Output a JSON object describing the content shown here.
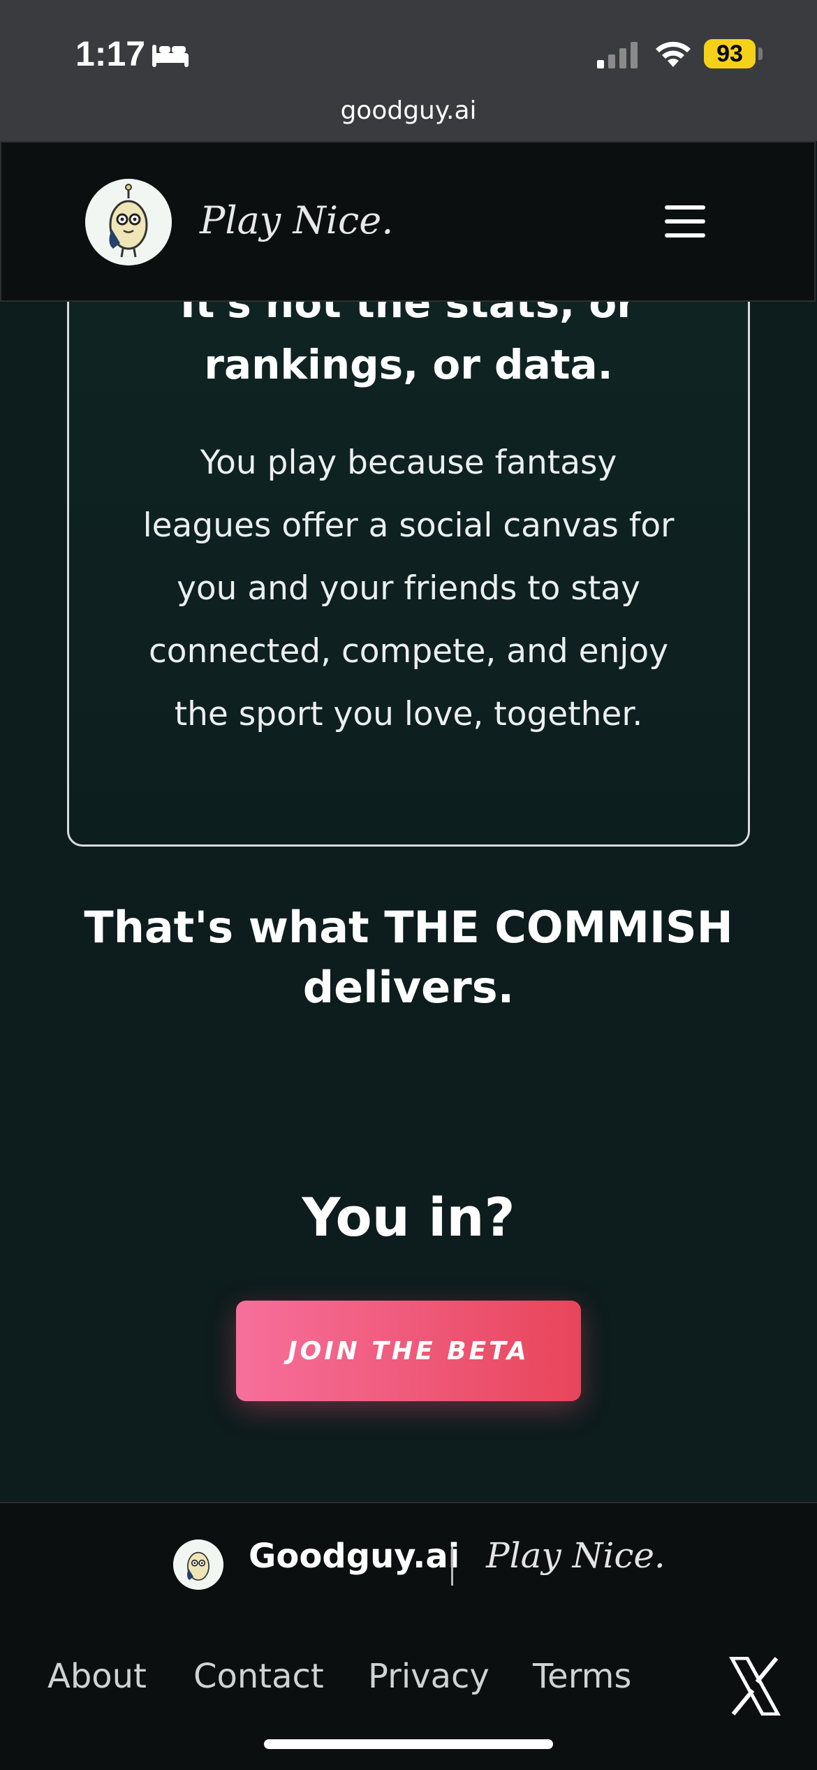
{
  "status": {
    "time": "1:17",
    "battery": "93",
    "url": "goodguy.ai"
  },
  "nav": {
    "tagline": "Play Nice."
  },
  "card": {
    "heading_partial": "It's not the stats, or",
    "heading": "rankings, or data.",
    "body": "You play because fantasy leagues offer a social canvas for you and your friends to stay connected, compete, and enjoy the sport you love, together."
  },
  "main": {
    "delivers": "That's what THE COMMISH delivers.",
    "question": "You in?",
    "cta": "JOIN THE BETA"
  },
  "footer": {
    "brand": "Goodguy.ai",
    "separator": "|",
    "tagline": "Play Nice.",
    "links": [
      "About",
      "Contact",
      "Privacy",
      "Terms"
    ]
  },
  "colors": {
    "page_bg": "#0d1c1c",
    "cta_start": "#f76f9c",
    "cta_end": "#e8455a",
    "battery": "#f5d11a"
  },
  "icons": {
    "status": [
      "bed-icon",
      "signal-icon",
      "wifi-icon"
    ],
    "nav": [
      "logo-mascot-icon",
      "hamburger-menu-icon"
    ],
    "footer": [
      "x-logo-icon"
    ]
  }
}
